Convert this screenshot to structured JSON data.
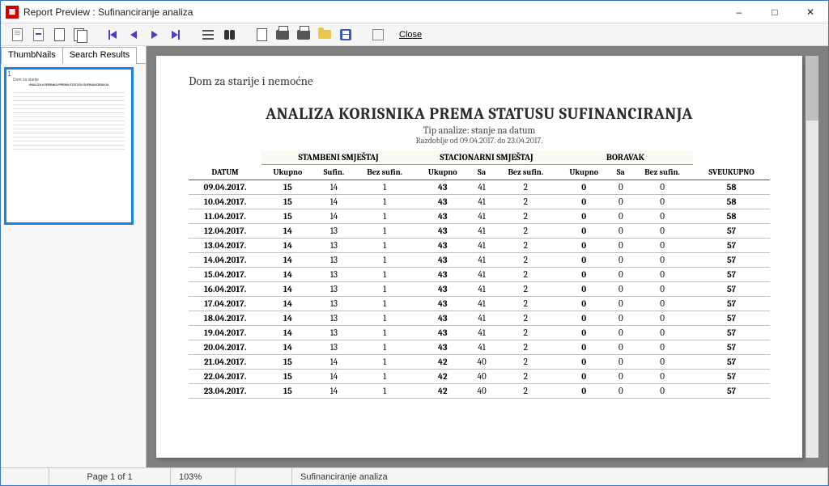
{
  "window": {
    "title": "Report Preview : Sufinanciranje analiza"
  },
  "toolbar": {
    "close": "Close"
  },
  "tabs": {
    "thumbnails": "ThumbNails",
    "search": "Search Results"
  },
  "thumb": {
    "num": "1"
  },
  "report": {
    "org": "Dom za starije i nemoćne",
    "title": "ANALIZA KORISNIKA PREMA STATUSU SUFINANCIRANJA",
    "subtitle": "Tip analize: stanje na datum",
    "period": "Razdoblje od 09.04.2017. do 23.04.2017.",
    "groups": {
      "g1": "STAMBENI SMJEŠTAJ",
      "g2": "STACIONARNI SMJEŠTAJ",
      "g3": "BORAVAK"
    },
    "cols": {
      "datum": "DATUM",
      "ukupno": "Ukupno",
      "sufin": "Sufin.",
      "bezsufin": "Bez sufin.",
      "sa": "Sa",
      "sveukupno": "SVEUKUPNO"
    },
    "rows": [
      {
        "d": "09.04.2017.",
        "a1": 15,
        "a2": 14,
        "a3": 1,
        "b1": 43,
        "b2": 41,
        "b3": 2,
        "c1": 0,
        "c2": 0,
        "c3": 0,
        "t": 58
      },
      {
        "d": "10.04.2017.",
        "a1": 15,
        "a2": 14,
        "a3": 1,
        "b1": 43,
        "b2": 41,
        "b3": 2,
        "c1": 0,
        "c2": 0,
        "c3": 0,
        "t": 58
      },
      {
        "d": "11.04.2017.",
        "a1": 15,
        "a2": 14,
        "a3": 1,
        "b1": 43,
        "b2": 41,
        "b3": 2,
        "c1": 0,
        "c2": 0,
        "c3": 0,
        "t": 58
      },
      {
        "d": "12.04.2017.",
        "a1": 14,
        "a2": 13,
        "a3": 1,
        "b1": 43,
        "b2": 41,
        "b3": 2,
        "c1": 0,
        "c2": 0,
        "c3": 0,
        "t": 57
      },
      {
        "d": "13.04.2017.",
        "a1": 14,
        "a2": 13,
        "a3": 1,
        "b1": 43,
        "b2": 41,
        "b3": 2,
        "c1": 0,
        "c2": 0,
        "c3": 0,
        "t": 57
      },
      {
        "d": "14.04.2017.",
        "a1": 14,
        "a2": 13,
        "a3": 1,
        "b1": 43,
        "b2": 41,
        "b3": 2,
        "c1": 0,
        "c2": 0,
        "c3": 0,
        "t": 57
      },
      {
        "d": "15.04.2017.",
        "a1": 14,
        "a2": 13,
        "a3": 1,
        "b1": 43,
        "b2": 41,
        "b3": 2,
        "c1": 0,
        "c2": 0,
        "c3": 0,
        "t": 57
      },
      {
        "d": "16.04.2017.",
        "a1": 14,
        "a2": 13,
        "a3": 1,
        "b1": 43,
        "b2": 41,
        "b3": 2,
        "c1": 0,
        "c2": 0,
        "c3": 0,
        "t": 57
      },
      {
        "d": "17.04.2017.",
        "a1": 14,
        "a2": 13,
        "a3": 1,
        "b1": 43,
        "b2": 41,
        "b3": 2,
        "c1": 0,
        "c2": 0,
        "c3": 0,
        "t": 57
      },
      {
        "d": "18.04.2017.",
        "a1": 14,
        "a2": 13,
        "a3": 1,
        "b1": 43,
        "b2": 41,
        "b3": 2,
        "c1": 0,
        "c2": 0,
        "c3": 0,
        "t": 57
      },
      {
        "d": "19.04.2017.",
        "a1": 14,
        "a2": 13,
        "a3": 1,
        "b1": 43,
        "b2": 41,
        "b3": 2,
        "c1": 0,
        "c2": 0,
        "c3": 0,
        "t": 57
      },
      {
        "d": "20.04.2017.",
        "a1": 14,
        "a2": 13,
        "a3": 1,
        "b1": 43,
        "b2": 41,
        "b3": 2,
        "c1": 0,
        "c2": 0,
        "c3": 0,
        "t": 57
      },
      {
        "d": "21.04.2017.",
        "a1": 15,
        "a2": 14,
        "a3": 1,
        "b1": 42,
        "b2": 40,
        "b3": 2,
        "c1": 0,
        "c2": 0,
        "c3": 0,
        "t": 57
      },
      {
        "d": "22.04.2017.",
        "a1": 15,
        "a2": 14,
        "a3": 1,
        "b1": 42,
        "b2": 40,
        "b3": 2,
        "c1": 0,
        "c2": 0,
        "c3": 0,
        "t": 57
      },
      {
        "d": "23.04.2017.",
        "a1": 15,
        "a2": 14,
        "a3": 1,
        "b1": 42,
        "b2": 40,
        "b3": 2,
        "c1": 0,
        "c2": 0,
        "c3": 0,
        "t": 57
      }
    ]
  },
  "status": {
    "page": "Page 1 of 1",
    "zoom": "103%",
    "name": "Sufinanciranje analiza"
  }
}
